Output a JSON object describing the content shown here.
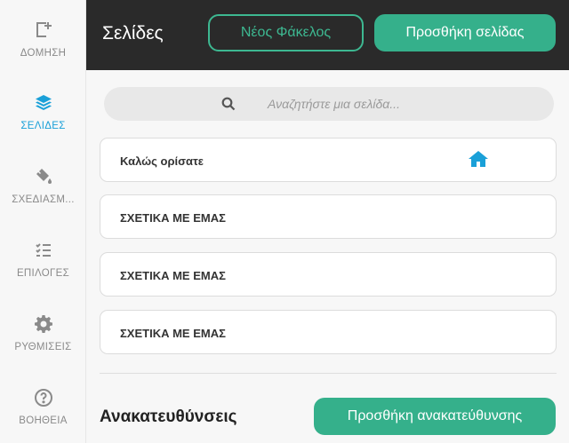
{
  "sidebar": {
    "items": [
      {
        "label": "ΔΟΜΗΣΗ",
        "icon": "build-icon"
      },
      {
        "label": "ΣΕΛΙΔΕΣ",
        "icon": "layers-icon",
        "active": true
      },
      {
        "label": "ΣΧΕΔΙΑΣΜ...",
        "icon": "paint-bucket-icon"
      },
      {
        "label": "ΕΠΙΛΟΓΕΣ",
        "icon": "checklist-icon"
      },
      {
        "label": "ΡΥΘΜΙΣΕΙΣ",
        "icon": "gear-icon"
      },
      {
        "label": "ΒΟΗΘΕΙΑ",
        "icon": "help-icon"
      }
    ]
  },
  "header": {
    "title": "Σελίδες",
    "new_folder_label": "Νέος Φάκελος",
    "add_page_label": "Προσθήκη σελίδας"
  },
  "search": {
    "placeholder": "Αναζητήστε μια σελίδα..."
  },
  "pages": [
    {
      "label": "Καλώς ορίσατε",
      "is_home": true
    },
    {
      "label": "ΣΧΕΤΙΚΑ ΜΕ ΕΜΑΣ"
    },
    {
      "label": "ΣΧΕΤΙΚΑ ΜΕ ΕΜΑΣ"
    },
    {
      "label": "ΣΧΕΤΙΚΑ ΜΕ ΕΜΑΣ"
    }
  ],
  "redirects": {
    "title": "Ανακατευθύνσεις",
    "add_label": "Προσθήκη ανακατεύθυνσης"
  },
  "colors": {
    "accent_green": "#35b08b",
    "active_blue": "#1aa0d8",
    "header_bg": "#2a2a2a"
  }
}
